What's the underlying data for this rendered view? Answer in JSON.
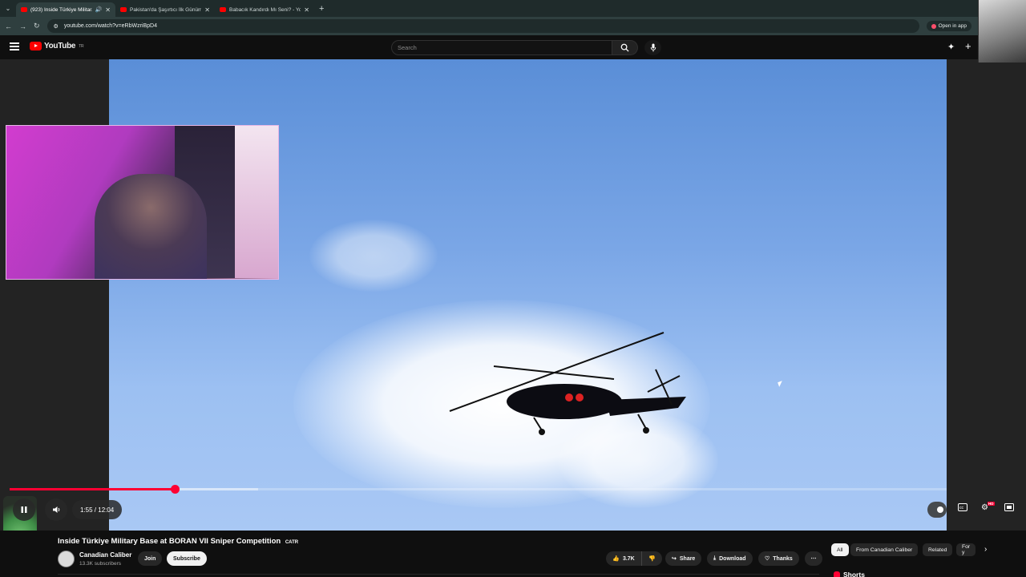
{
  "browser": {
    "tabs": [
      {
        "title": "(923) Inside Türkiye Militar...",
        "active": true
      },
      {
        "title": "Pakistan'da Şaşırtıcı İlk Günüm",
        "active": false
      },
      {
        "title": "Babacık Kandırdı Mı Seni? - You",
        "active": false
      }
    ],
    "url": "youtube.com/watch?v=eRbWzriBpD4",
    "open_in_app": "Open in app"
  },
  "masthead": {
    "logo_text": "YouTube",
    "region": "TR",
    "search_placeholder": "Search"
  },
  "player": {
    "time_display": "1:55 / 12:04",
    "progress_fraction": 0.176,
    "buffered_fraction": 0.265,
    "hd_badge": "HD"
  },
  "video": {
    "title": "Inside Türkiye Military Base at BORAN VII Sniper Competition",
    "title_suffix": "CATR",
    "channel_name": "Canadian Caliber",
    "subscribers": "13.3K subscribers",
    "join_label": "Join",
    "subscribe_label": "Subscribe",
    "like_count": "3.7K",
    "share_label": "Share",
    "download_label": "Download",
    "thanks_label": "Thanks"
  },
  "chips": [
    "All",
    "From Canadian Caliber",
    "Related",
    "For y"
  ],
  "shorts_label": "Shorts",
  "colors": {
    "accent": "#ff0033",
    "brand": "#ff0000"
  }
}
